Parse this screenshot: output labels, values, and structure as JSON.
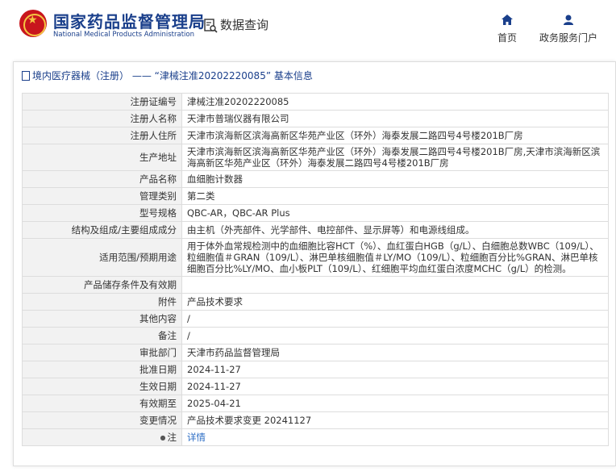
{
  "header": {
    "title_cn": "国家药品监督管理局",
    "title_en": "National Medical Products Administration",
    "query_label": "数据查询",
    "nav": [
      {
        "label": "首页",
        "icon": "home-icon"
      },
      {
        "label": "政务服务门户",
        "icon": "user-icon"
      }
    ]
  },
  "breadcrumb": "境内医疗器械（注册） —— “津械注准20202220085” 基本信息",
  "rows": [
    {
      "key": "注册证编号",
      "value": "津械注准20202220085"
    },
    {
      "key": "注册人名称",
      "value": "天津市普瑞仪器有限公司"
    },
    {
      "key": "注册人住所",
      "value": "天津市滨海新区滨海高新区华苑产业区（环外）海泰发展二路四号4号楼201B厂房"
    },
    {
      "key": "生产地址",
      "value": "天津市滨海新区滨海高新区华苑产业区（环外）海泰发展二路四号4号楼201B厂房,天津市滨海新区滨海高新区华苑产业区（环外）海泰发展二路四号4号楼201B厂房"
    },
    {
      "key": "产品名称",
      "value": "血细胞计数器"
    },
    {
      "key": "管理类别",
      "value": "第二类"
    },
    {
      "key": "型号规格",
      "value": "QBC-AR，QBC-AR Plus"
    },
    {
      "key": "结构及组成/主要组成成分",
      "value": "由主机（外壳部件、光学部件、电控部件、显示屏等）和电源线组成。"
    },
    {
      "key": "适用范围/预期用途",
      "value": "用于体外血常规检测中的血细胞比容HCT（%）、血红蛋白HGB（g/L）、白细胞总数WBC（109/L）、粒细胞值＃GRAN（109/L）、淋巴单核细胞值＃LY/MO（109/L）、粒细胞百分比%GRAN、淋巴单核细胞百分比%LY/MO、血小板PLT（109/L）、红细胞平均血红蛋白浓度MCHC（g/L）的检测。"
    },
    {
      "key": "产品储存条件及有效期",
      "value": ""
    },
    {
      "key": "附件",
      "value": "产品技术要求"
    },
    {
      "key": "其他内容",
      "value": "/"
    },
    {
      "key": "备注",
      "value": "/"
    },
    {
      "key": "审批部门",
      "value": "天津市药品监督管理局"
    },
    {
      "key": "批准日期",
      "value": "2024-11-27"
    },
    {
      "key": "生效日期",
      "value": "2024-11-27"
    },
    {
      "key": "有效期至",
      "value": "2025-04-21"
    },
    {
      "key": "变更情况",
      "value": "产品技术要求变更 20241127"
    },
    {
      "key": "注",
      "value": "详情",
      "icon": "pin-icon"
    }
  ],
  "colors": {
    "brand": "#1a3f8b",
    "label_bg": "#f2f2f2",
    "link": "#2b6cc4",
    "logo_red": "#c8161d"
  }
}
